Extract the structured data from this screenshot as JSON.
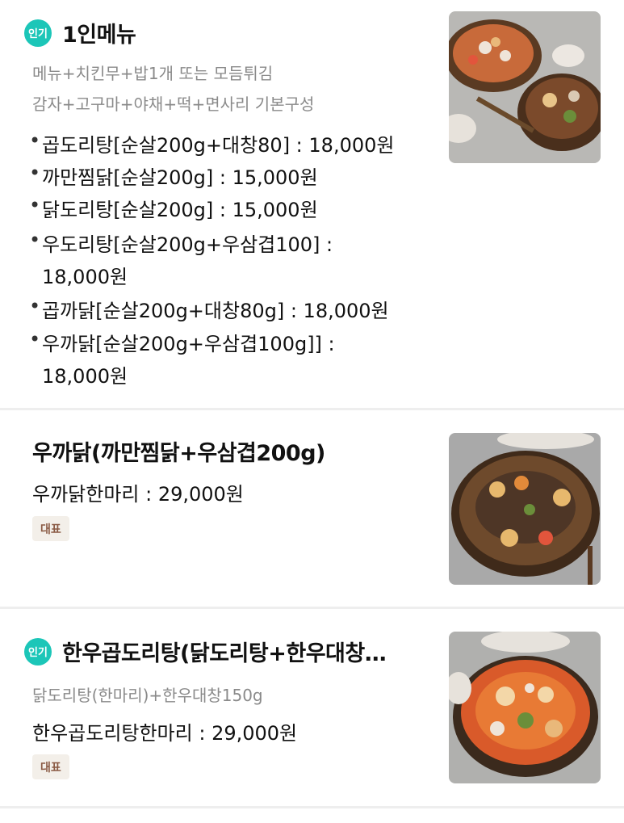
{
  "items": [
    {
      "badge": "인기",
      "title": "1인메뉴",
      "subtitle_lines": [
        "메뉴+치킨무+밥1개 또는 모듬튀김",
        "감자+고구마+야채+떡+면사리 기본구성"
      ],
      "bullet": "•",
      "options": [
        "곱도리탕[순살200g+대창80] : 18,000원",
        "까만찜닭[순살200g] : 15,000원",
        "닭도리탕[순살200g] : 15,000원",
        "우도리탕[순살200g+우삼겹100] :",
        "18,000원",
        "곱까닭[순살200g+대창80g] : 18,000원",
        "우까닭[순살200g+우삼겹100g]] :",
        "18,000원"
      ],
      "image_icon": "food-photo"
    },
    {
      "title": "우까닭(까만찜닭+우삼겹200g)",
      "price_line": "우까닭한마리 : 29,000원",
      "tag": "대표",
      "image_icon": "food-photo"
    },
    {
      "badge": "인기",
      "title": "한우곱도리탕(닭도리탕+한우대창…",
      "subtitle": "닭도리탕(한마리)+한우대창150g",
      "price_line": "한우곱도리탕한마리 : 29,000원",
      "tag": "대표",
      "image_icon": "food-photo"
    }
  ],
  "colors": {
    "badge": "#1cc6b8",
    "tag_bg": "#f3efe9",
    "tag_text": "#8a5a44",
    "subtext": "#8a8a8a"
  }
}
